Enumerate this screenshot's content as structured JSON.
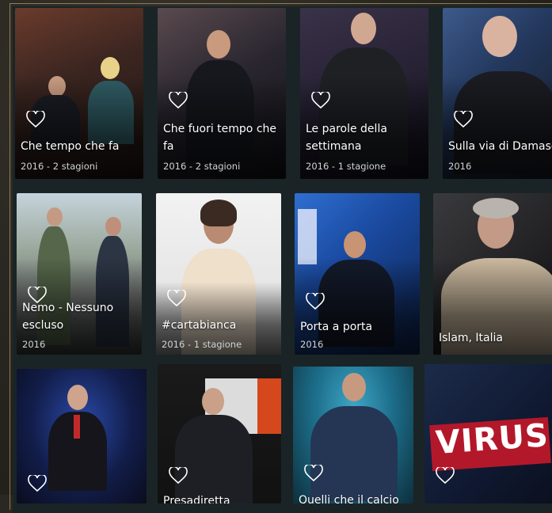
{
  "cards": [
    {
      "title": "Che tempo che fa",
      "meta": "2016 - 2 stagioni"
    },
    {
      "title": "Che fuori tempo che\nfa",
      "meta": "2016 - 2 stagioni"
    },
    {
      "title": "Le parole della\nsettimana",
      "meta": "2016 - 1 stagione"
    },
    {
      "title": "Sulla via di Damasco",
      "meta": "2016"
    },
    {
      "title": "Nemo - Nessuno\nescluso",
      "meta": "2016"
    },
    {
      "title": "#cartabianca",
      "meta": "2016 - 1 stagione"
    },
    {
      "title": "Porta a porta",
      "meta": "2016"
    },
    {
      "title": "Islam, Italia",
      "meta": ""
    },
    {
      "title": "",
      "meta": ""
    },
    {
      "title": "Presadiretta",
      "meta": ""
    },
    {
      "title": "Quelli che il calcio",
      "meta": ""
    },
    {
      "title": "",
      "meta": "",
      "logo": "VIRUS"
    }
  ],
  "icon": "heart-outline-icon"
}
